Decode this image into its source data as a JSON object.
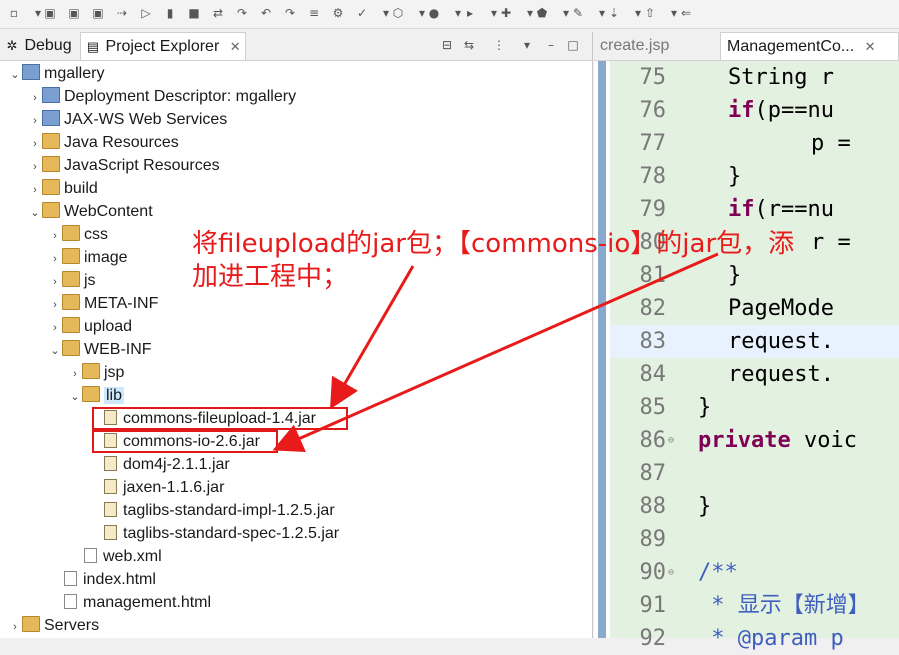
{
  "left_view": {
    "tabs": {
      "debug": "Debug",
      "project_explorer": "Project Explorer"
    },
    "tree": [
      {
        "label": "mgallery",
        "arrow": "⌄"
      },
      {
        "label": "Deployment Descriptor: mgallery",
        "arrow": "›"
      },
      {
        "label": "JAX-WS Web Services",
        "arrow": "›"
      },
      {
        "label": "Java Resources",
        "arrow": "›"
      },
      {
        "label": "JavaScript Resources",
        "arrow": "›"
      },
      {
        "label": "build",
        "arrow": "›"
      },
      {
        "label": "WebContent",
        "arrow": "⌄"
      },
      {
        "label": "css",
        "arrow": "›"
      },
      {
        "label": "image",
        "arrow": "›"
      },
      {
        "label": "js",
        "arrow": "›"
      },
      {
        "label": "META-INF",
        "arrow": "›"
      },
      {
        "label": "upload",
        "arrow": "›"
      },
      {
        "label": "WEB-INF",
        "arrow": "⌄"
      },
      {
        "label": "jsp",
        "arrow": "›"
      },
      {
        "label": "lib",
        "arrow": "⌄"
      },
      {
        "label": "commons-fileupload-1.4.jar",
        "arrow": ""
      },
      {
        "label": "commons-io-2.6.jar",
        "arrow": ""
      },
      {
        "label": "dom4j-2.1.1.jar",
        "arrow": ""
      },
      {
        "label": "jaxen-1.1.6.jar",
        "arrow": ""
      },
      {
        "label": "taglibs-standard-impl-1.2.5.jar",
        "arrow": ""
      },
      {
        "label": "taglibs-standard-spec-1.2.5.jar",
        "arrow": ""
      },
      {
        "label": "web.xml",
        "arrow": ""
      },
      {
        "label": "index.html",
        "arrow": ""
      },
      {
        "label": "management.html",
        "arrow": ""
      },
      {
        "label": "Servers",
        "arrow": "›"
      }
    ]
  },
  "editor": {
    "tabs": {
      "create": "create.jsp",
      "management": "ManagementCo..."
    },
    "lines": [
      {
        "num": "75",
        "code": "String r"
      },
      {
        "num": "76",
        "kw": "if",
        "code": "(p==nu"
      },
      {
        "num": "77",
        "code": "    p = "
      },
      {
        "num": "78",
        "code": "}"
      },
      {
        "num": "79",
        "kw": "if",
        "code": "(r==nu"
      },
      {
        "num": "80",
        "code": "    r = "
      },
      {
        "num": "81",
        "code": "}"
      },
      {
        "num": "82",
        "code": "PageMode"
      },
      {
        "num": "83",
        "code": "request."
      },
      {
        "num": "84",
        "code": "request."
      },
      {
        "num": "85",
        "code": "}"
      },
      {
        "num": "86",
        "kw": "private",
        "code": " voic"
      },
      {
        "num": "87",
        "code": ""
      },
      {
        "num": "88",
        "code": "}"
      },
      {
        "num": "89",
        "code": ""
      },
      {
        "num": "90",
        "code": "/**"
      },
      {
        "num": "91",
        "code": " * 显示【新增】"
      },
      {
        "num": "92",
        "code": " * @param p"
      }
    ]
  },
  "annotation": {
    "line1": "将fileupload的jar包；【commons-io】的jar包，添",
    "line2": "加进工程中；"
  },
  "colors": {
    "annotation": "#e81a1a",
    "code_bg": "#e3f1e0",
    "keyword": "#7f0055"
  }
}
